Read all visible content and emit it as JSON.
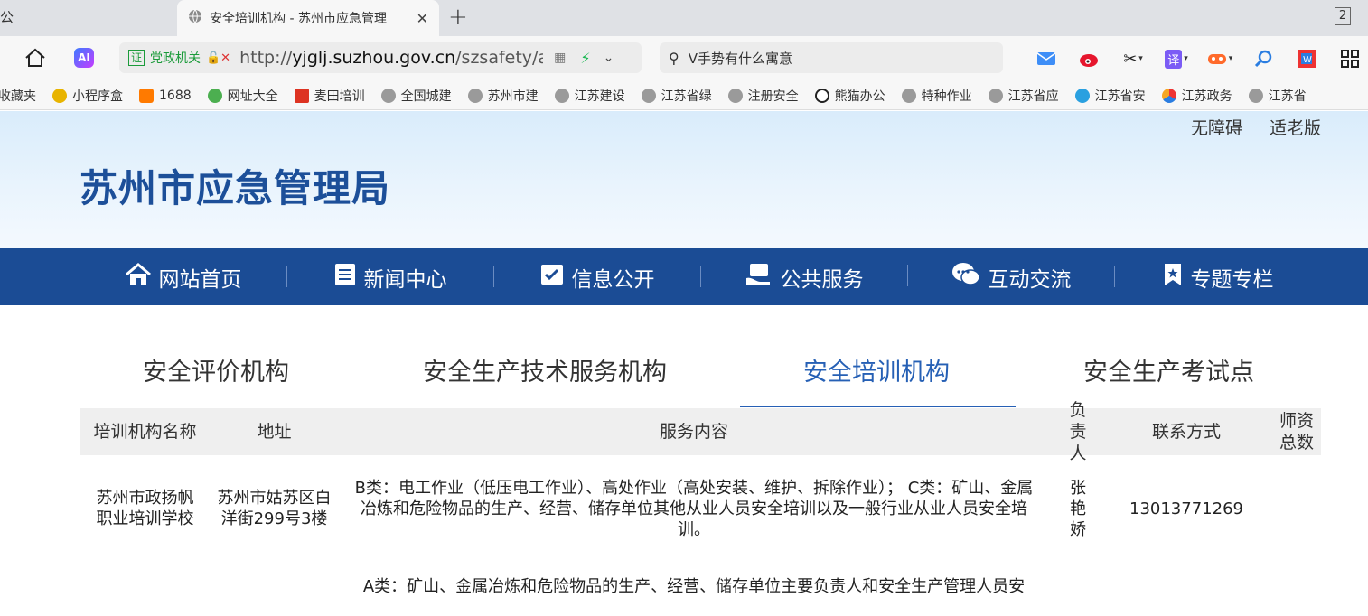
{
  "browser": {
    "left_tab_fragment": "公",
    "active_tab_title": "安全培训机构 - 苏州市应急管理",
    "tab_count": "2",
    "address": {
      "party_label": "党政机关",
      "url_prefix": "http://",
      "url_domain": "yjglj.suzhou.gov.cn",
      "url_path": "/szsafety/aqpxj"
    },
    "search_placeholder": "V手势有什么寓意",
    "bookmarks": [
      "收藏夹",
      "小程序盒",
      "1688",
      "网址大全",
      "麦田培训",
      "全国城建",
      "苏州市建",
      "江苏建设",
      "江苏省绿",
      "注册安全",
      "熊猫办公",
      "特种作业",
      "江苏省应",
      "江苏省安",
      "江苏政务",
      "江苏省"
    ],
    "icons": {
      "home": "home-icon",
      "ai": "ai-icon",
      "toolbar": [
        "mail-icon",
        "weibo-icon",
        "scissors-icon",
        "translate-icon",
        "game-icon",
        "search-icon",
        "office-icon",
        "grid-icon"
      ]
    }
  },
  "site": {
    "accessibility": "无障碍",
    "elder_mode": "适老版",
    "title": "苏州市应急管理局",
    "nav": [
      {
        "label": "网站首页",
        "icon": "home-icon"
      },
      {
        "label": "新闻中心",
        "icon": "news-icon"
      },
      {
        "label": "信息公开",
        "icon": "info-icon"
      },
      {
        "label": "公共服务",
        "icon": "service-icon"
      },
      {
        "label": "互动交流",
        "icon": "chat-icon"
      },
      {
        "label": "专题专栏",
        "icon": "bookmark-icon"
      }
    ],
    "subtabs": [
      {
        "label": "安全评价机构",
        "active": false
      },
      {
        "label": "安全生产技术服务机构",
        "active": false
      },
      {
        "label": "安全培训机构",
        "active": true
      },
      {
        "label": "安全生产考试点",
        "active": false
      }
    ],
    "colors": {
      "brand": "#1b4c95",
      "title": "#1c4f99",
      "active_tab": "#2660b5"
    }
  },
  "table": {
    "headers": {
      "name": "培训机构名称",
      "address": "地址",
      "service": "服务内容",
      "person": "负责人",
      "phone": "联系方式",
      "teachers": "师资总数"
    },
    "rows": [
      {
        "name": "苏州市政扬帆职业培训学校",
        "address": "苏州市姑苏区白洋街299号3楼",
        "service": "B类：电工作业（低压电工作业）、高处作业（高处安装、维护、拆除作业）； C类：矿山、金属冶炼和危险物品的生产、经营、储存单位其他从业人员安全培训以及一般行业从业人员安全培训。",
        "person": "张艳娇",
        "phone": "13013771269",
        "teachers": ""
      },
      {
        "name": "",
        "address": "",
        "service": "A类：矿山、金属冶炼和危险物品的生产、经营、储存单位主要负责人和安全生产管理人员安",
        "person": "",
        "phone": "",
        "teachers": ""
      }
    ]
  }
}
